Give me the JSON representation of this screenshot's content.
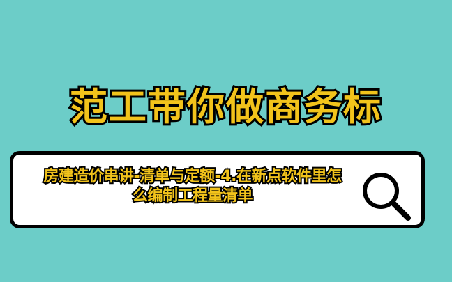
{
  "colors": {
    "background": "#6ccdc8",
    "headline_fill": "#f2c31b",
    "query_fill": "#f2c31b",
    "outline": "#000000",
    "box_fill": "#ffffff"
  },
  "headline": {
    "text": "范工带你做商务标"
  },
  "search": {
    "query": "房建造价串讲-清单与定额-4.在新点软件里怎么编制工程量清单",
    "icon": "search-icon"
  }
}
